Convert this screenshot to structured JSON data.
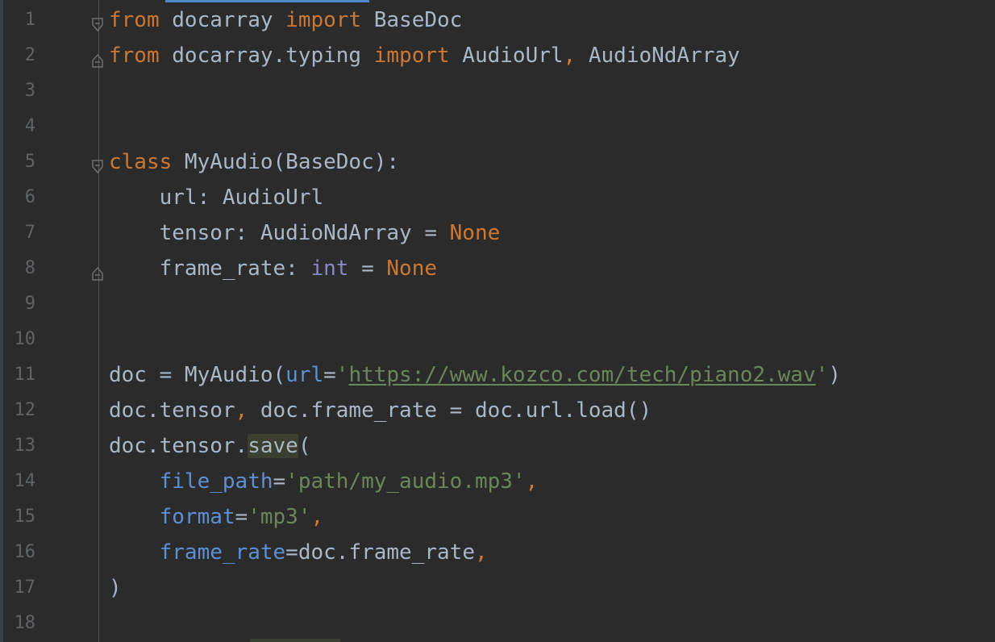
{
  "editor": {
    "lines": [
      {
        "num": "1",
        "tokens": [
          {
            "t": "from",
            "c": "kw"
          },
          {
            "t": " docarray ",
            "c": "plain"
          },
          {
            "t": "import",
            "c": "kw"
          },
          {
            "t": " BaseDoc",
            "c": "plain"
          }
        ]
      },
      {
        "num": "2",
        "tokens": [
          {
            "t": "from",
            "c": "kw"
          },
          {
            "t": " docarray.typing ",
            "c": "plain"
          },
          {
            "t": "import",
            "c": "kw"
          },
          {
            "t": " AudioUrl",
            "c": "plain"
          },
          {
            "t": ",",
            "c": "kw"
          },
          {
            "t": " AudioNdArray",
            "c": "plain"
          }
        ]
      },
      {
        "num": "3",
        "tokens": []
      },
      {
        "num": "4",
        "tokens": []
      },
      {
        "num": "5",
        "tokens": [
          {
            "t": "class",
            "c": "kw"
          },
          {
            "t": " MyAudio(BaseDoc):",
            "c": "plain"
          }
        ]
      },
      {
        "num": "6",
        "tokens": [
          {
            "t": "    url: AudioUrl",
            "c": "plain"
          }
        ]
      },
      {
        "num": "7",
        "tokens": [
          {
            "t": "    tensor: AudioNdArray = ",
            "c": "plain"
          },
          {
            "t": "None",
            "c": "kw"
          }
        ]
      },
      {
        "num": "8",
        "tokens": [
          {
            "t": "    frame_rate: ",
            "c": "plain"
          },
          {
            "t": "int",
            "c": "builtin"
          },
          {
            "t": " = ",
            "c": "plain"
          },
          {
            "t": "None",
            "c": "kw"
          }
        ]
      },
      {
        "num": "9",
        "tokens": []
      },
      {
        "num": "10",
        "tokens": []
      },
      {
        "num": "11",
        "tokens": [
          {
            "t": "doc = MyAudio(",
            "c": "plain"
          },
          {
            "t": "url",
            "c": "kwarg"
          },
          {
            "t": "=",
            "c": "plain"
          },
          {
            "t": "'",
            "c": "str"
          },
          {
            "t": "https://www.kozco.com/tech/piano2.wav",
            "c": "url"
          },
          {
            "t": "'",
            "c": "str"
          },
          {
            "t": ")",
            "c": "plain"
          }
        ]
      },
      {
        "num": "12",
        "tokens": [
          {
            "t": "doc.tensor",
            "c": "plain"
          },
          {
            "t": ",",
            "c": "kw"
          },
          {
            "t": " doc.frame_rate = doc.url.load()",
            "c": "plain"
          }
        ]
      },
      {
        "num": "13",
        "tokens": [
          {
            "t": "doc.tensor.",
            "c": "plain"
          },
          {
            "t": "save",
            "c": "plain hl"
          },
          {
            "t": "(",
            "c": "plain"
          }
        ]
      },
      {
        "num": "14",
        "tokens": [
          {
            "t": "    ",
            "c": "plain"
          },
          {
            "t": "file_path",
            "c": "kwarg"
          },
          {
            "t": "=",
            "c": "plain"
          },
          {
            "t": "'path/my_audio.mp3'",
            "c": "str"
          },
          {
            "t": ",",
            "c": "kw"
          }
        ]
      },
      {
        "num": "15",
        "tokens": [
          {
            "t": "    ",
            "c": "plain"
          },
          {
            "t": "format",
            "c": "kwarg"
          },
          {
            "t": "=",
            "c": "plain"
          },
          {
            "t": "'mp3'",
            "c": "str"
          },
          {
            "t": ",",
            "c": "kw"
          }
        ]
      },
      {
        "num": "16",
        "tokens": [
          {
            "t": "    ",
            "c": "plain"
          },
          {
            "t": "frame_rate",
            "c": "kwarg"
          },
          {
            "t": "=doc.frame_rate",
            "c": "plain"
          },
          {
            "t": ",",
            "c": "kw"
          }
        ]
      },
      {
        "num": "17",
        "tokens": [
          {
            "t": ")",
            "c": "plain"
          }
        ]
      },
      {
        "num": "18",
        "tokens": []
      }
    ],
    "fold_markers": {
      "1": "fold-open",
      "2": "fold-close",
      "5": "fold-open",
      "8": "fold-close"
    },
    "colors": {
      "background": "#2b2b2b",
      "keyword": "#cc7832",
      "text": "#a9b7c6",
      "string": "#6a8759",
      "kwarg": "#5c8fd6",
      "builtin": "#8888c6",
      "line_number": "#606366"
    }
  }
}
